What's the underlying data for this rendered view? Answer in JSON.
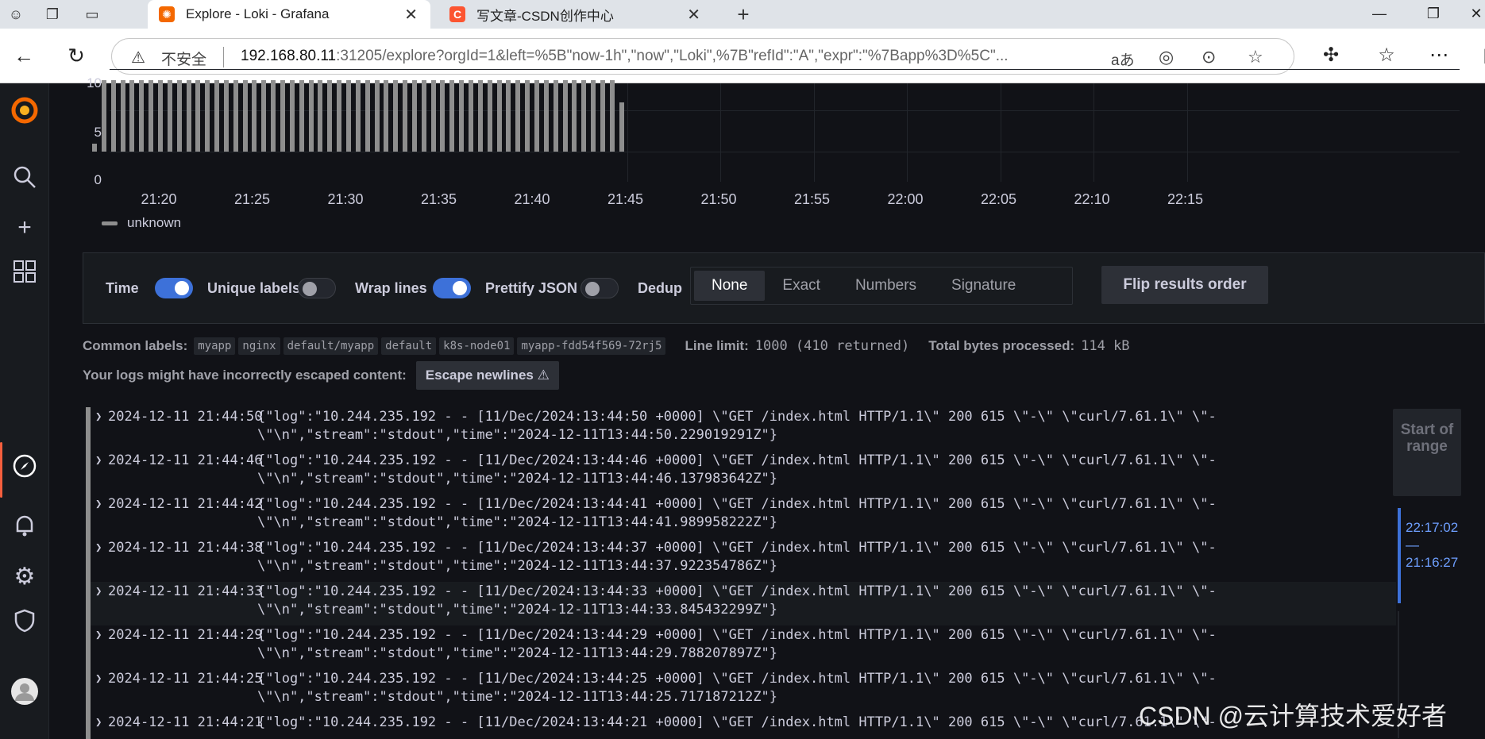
{
  "browser": {
    "tabs": [
      {
        "title": "Explore - Loki - Grafana",
        "active": true
      },
      {
        "title": "写文章-CSDN创作中心",
        "active": false
      }
    ],
    "security_label": "不安全",
    "url_host": "192.168.80.11",
    "url_rest": ":31205/explore?orgId=1&left=%5B\"now-1h\",\"now\",\"Loki\",%7B\"refId\":\"A\",\"expr\":\"%7Bapp%3D%5C\"...",
    "read_aloud_icon": "aあ"
  },
  "sidebar": {
    "icons": [
      "grafana-logo",
      "search-icon",
      "plus-icon",
      "dashboards-icon",
      "explore-icon",
      "bell-icon",
      "gear-icon",
      "shield-icon",
      "avatar"
    ]
  },
  "chart_data": {
    "type": "bar",
    "y_ticks": [
      "10",
      "5",
      "0"
    ],
    "x_ticks": [
      "21:20",
      "21:25",
      "21:30",
      "21:35",
      "21:40",
      "21:45",
      "21:50",
      "21:55",
      "22:00",
      "22:05",
      "22:10",
      "22:15"
    ],
    "series": [
      {
        "name": "unknown",
        "color": "#8e8e8e"
      }
    ],
    "ylim": [
      0,
      10
    ]
  },
  "options": {
    "time_label": "Time",
    "unique_labels_label": "Unique labels",
    "wrap_lines_label": "Wrap lines",
    "prettify_json_label": "Prettify JSON",
    "dedup_label": "Dedup",
    "dedup_options": [
      "None",
      "Exact",
      "Numbers",
      "Signature"
    ],
    "dedup_selected": "None",
    "flip_label": "Flip results order"
  },
  "meta": {
    "common_labels_label": "Common labels:",
    "common_labels": [
      "myapp",
      "nginx",
      "default/myapp",
      "default",
      "k8s-node01",
      "myapp-fdd54f569-72rj5"
    ],
    "line_limit_label": "Line limit:",
    "line_limit_value": "1000 (410 returned)",
    "bytes_label": "Total bytes processed:",
    "bytes_value": "114 kB",
    "escape_msg": "Your logs might have incorrectly escaped content:",
    "escape_btn": "Escape newlines ⚠"
  },
  "logs": [
    {
      "ts": "2024-12-11 21:44:50",
      "l1": "{\"log\":\"10.244.235.192 - - [11/Dec/2024:13:44:50 +0000] \\\"GET /index.html HTTP/1.1\\\" 200 615 \\\"-\\\" \\\"curl/7.61.1\\\" \\\"-",
      "l2": "\\\"\\n\",\"stream\":\"stdout\",\"time\":\"2024-12-11T13:44:50.229019291Z\"}"
    },
    {
      "ts": "2024-12-11 21:44:46",
      "l1": "{\"log\":\"10.244.235.192 - - [11/Dec/2024:13:44:46 +0000] \\\"GET /index.html HTTP/1.1\\\" 200 615 \\\"-\\\" \\\"curl/7.61.1\\\" \\\"-",
      "l2": "\\\"\\n\",\"stream\":\"stdout\",\"time\":\"2024-12-11T13:44:46.137983642Z\"}"
    },
    {
      "ts": "2024-12-11 21:44:42",
      "l1": "{\"log\":\"10.244.235.192 - - [11/Dec/2024:13:44:41 +0000] \\\"GET /index.html HTTP/1.1\\\" 200 615 \\\"-\\\" \\\"curl/7.61.1\\\" \\\"-",
      "l2": "\\\"\\n\",\"stream\":\"stdout\",\"time\":\"2024-12-11T13:44:41.989958222Z\"}"
    },
    {
      "ts": "2024-12-11 21:44:38",
      "l1": "{\"log\":\"10.244.235.192 - - [11/Dec/2024:13:44:37 +0000] \\\"GET /index.html HTTP/1.1\\\" 200 615 \\\"-\\\" \\\"curl/7.61.1\\\" \\\"-",
      "l2": "\\\"\\n\",\"stream\":\"stdout\",\"time\":\"2024-12-11T13:44:37.922354786Z\"}"
    },
    {
      "ts": "2024-12-11 21:44:33",
      "l1": "{\"log\":\"10.244.235.192 - - [11/Dec/2024:13:44:33 +0000] \\\"GET /index.html HTTP/1.1\\\" 200 615 \\\"-\\\" \\\"curl/7.61.1\\\" \\\"-",
      "l2": "\\\"\\n\",\"stream\":\"stdout\",\"time\":\"2024-12-11T13:44:33.845432299Z\"}"
    },
    {
      "ts": "2024-12-11 21:44:29",
      "l1": "{\"log\":\"10.244.235.192 - - [11/Dec/2024:13:44:29 +0000] \\\"GET /index.html HTTP/1.1\\\" 200 615 \\\"-\\\" \\\"curl/7.61.1\\\" \\\"-",
      "l2": "\\\"\\n\",\"stream\":\"stdout\",\"time\":\"2024-12-11T13:44:29.788207897Z\"}"
    },
    {
      "ts": "2024-12-11 21:44:25",
      "l1": "{\"log\":\"10.244.235.192 - - [11/Dec/2024:13:44:25 +0000] \\\"GET /index.html HTTP/1.1\\\" 200 615 \\\"-\\\" \\\"curl/7.61.1\\\" \\\"-",
      "l2": "\\\"\\n\",\"stream\":\"stdout\",\"time\":\"2024-12-11T13:44:25.717187212Z\"}"
    },
    {
      "ts": "2024-12-11 21:44:21",
      "l1": "{\"log\":\"10.244.235.192 - - [11/Dec/2024:13:44:21 +0000] \\\"GET /index.html HTTP/1.1\\\" 200 615 \\\"-\\\" \\\"curl/7.61.1\\\" \\\"-",
      "l2": ""
    }
  ],
  "range": {
    "start_label": "Start of range",
    "from": "22:17:02",
    "dash": "—",
    "to": "21:16:27"
  },
  "watermark": "CSDN @云计算技术爱好者"
}
